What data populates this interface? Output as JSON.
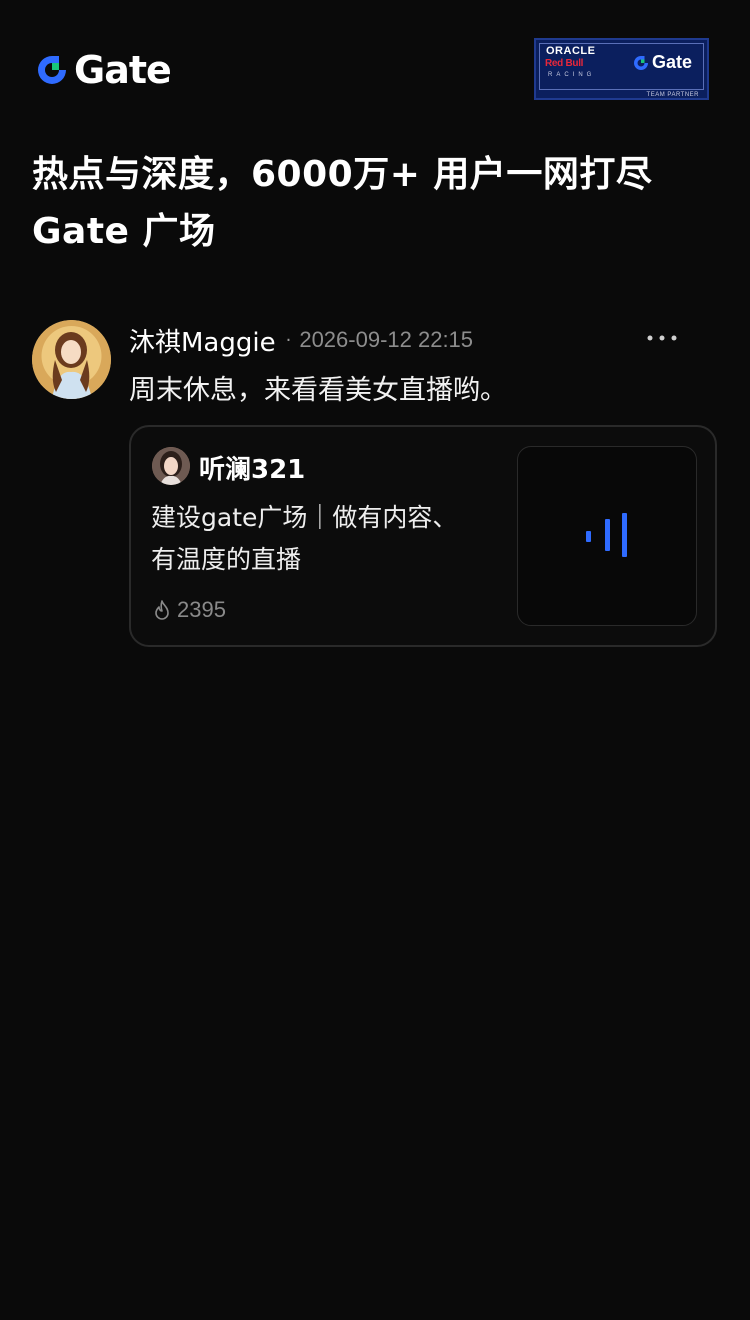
{
  "header": {
    "logo_text": "Gate",
    "partner_badge": {
      "line1": "ORACLE",
      "line2": "Red Bull",
      "line3": "RACING",
      "brand": "Gate",
      "caption": "TEAM PARTNER"
    }
  },
  "headline": {
    "line1": "热点与深度，6000万+ 用户一网打尽",
    "line2": "Gate 广场"
  },
  "post": {
    "author": "沐祺Maggie",
    "separator": "·",
    "timestamp": "2026-09-12 22:15",
    "more_label": "···",
    "text": "周末休息，来看看美女直播哟。",
    "live_card": {
      "host_name": "听澜321",
      "title_line1": "建设gate广场｜做有内容、",
      "title_line2": "有温度的直播",
      "heat_count": "2395",
      "heat_icon": "flame-icon",
      "thumbnail_icon": "live-bars-icon"
    }
  },
  "colors": {
    "background": "#0a0a0a",
    "accent_blue": "#2f6bff",
    "logo_green": "#18c57a",
    "muted_text": "#8d8d8d"
  }
}
